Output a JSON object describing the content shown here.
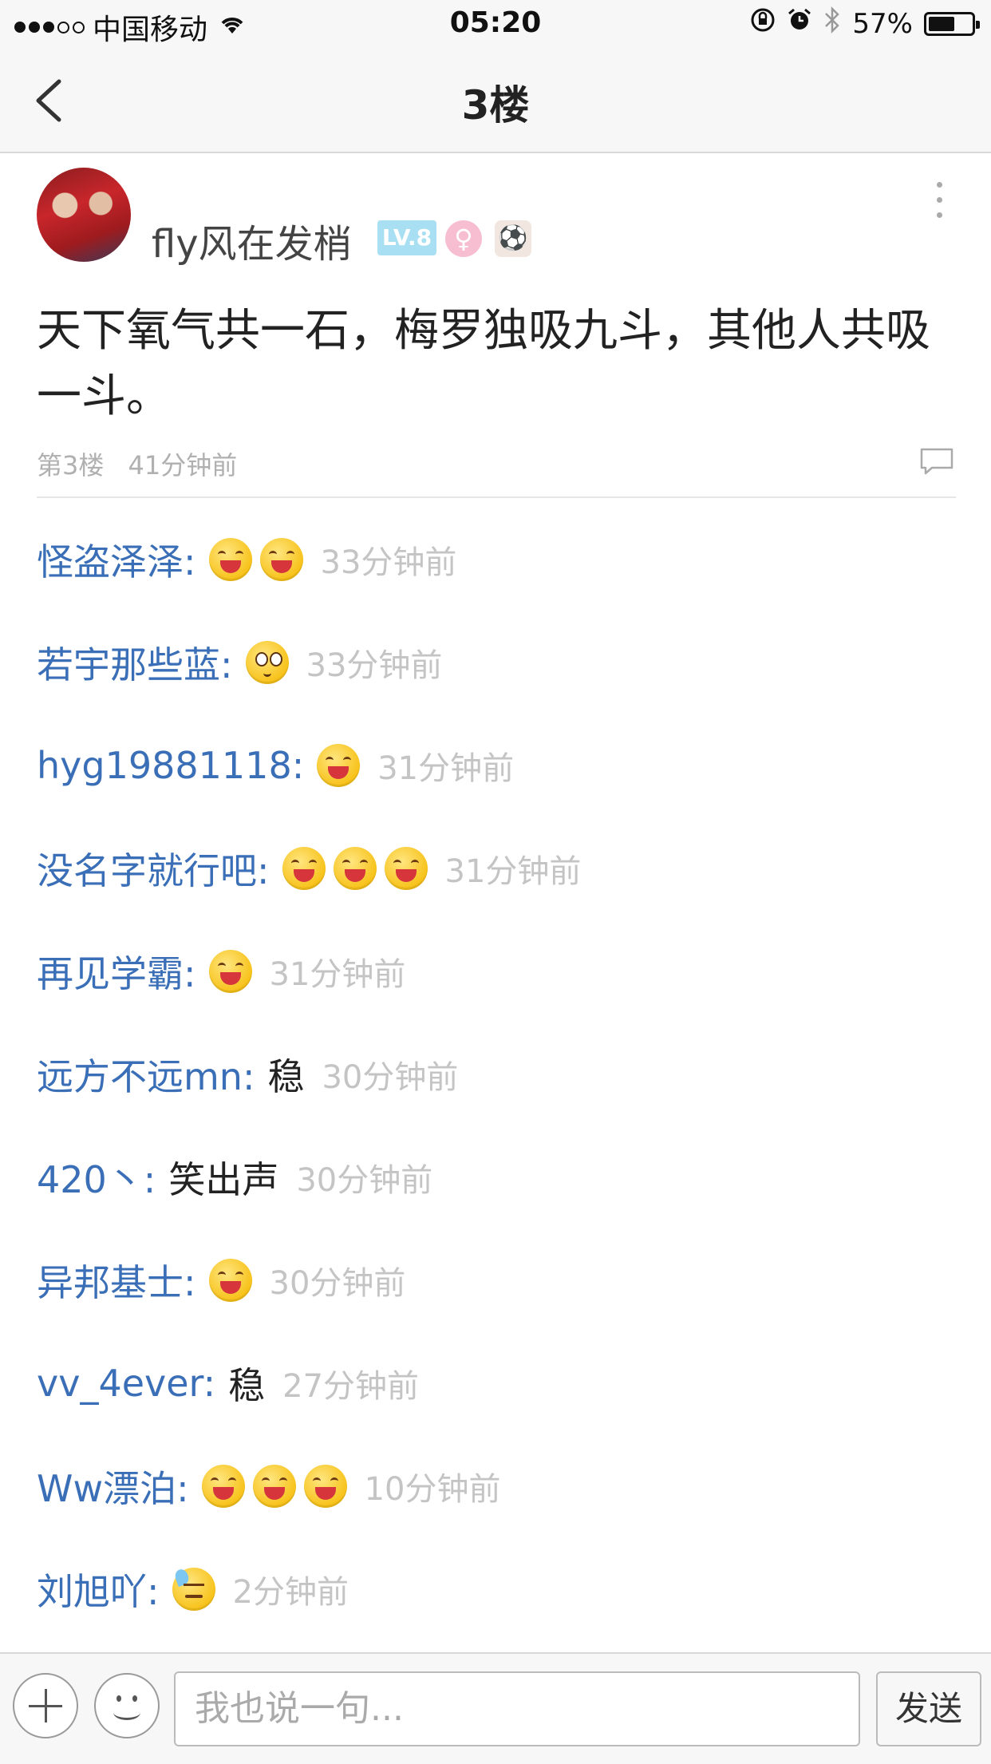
{
  "status_bar": {
    "carrier": "中国移动",
    "time": "05:20",
    "battery": "57%",
    "battery_level": 0.57
  },
  "nav": {
    "title": "3楼"
  },
  "post": {
    "username": "fly风在发梢",
    "level_badge": "LV.8",
    "gender_icon": "female-symbol-icon",
    "content": "天下氧气共一石，梅罗独吸九斗，其他人共吸一斗。",
    "floor": "第3楼",
    "time": "41分钟前"
  },
  "replies": [
    {
      "name": "怪盗泽泽:",
      "text": "",
      "emojis": [
        "laugh",
        "laugh"
      ],
      "time": "33分钟前"
    },
    {
      "name": "若宇那些蓝:",
      "text": "",
      "emojis": [
        "shy"
      ],
      "time": "33分钟前"
    },
    {
      "name": "hyg19881118:",
      "text": "",
      "emojis": [
        "laugh"
      ],
      "time": "31分钟前"
    },
    {
      "name": "没名字就行吧:",
      "text": "",
      "emojis": [
        "laugh",
        "laugh",
        "laugh"
      ],
      "time": "31分钟前"
    },
    {
      "name": "再见学霸:",
      "text": "",
      "emojis": [
        "laugh"
      ],
      "time": "31分钟前"
    },
    {
      "name": "远方不远mn:",
      "text": "稳",
      "emojis": [],
      "time": "30分钟前"
    },
    {
      "name": "420丶:",
      "text": "笑出声",
      "emojis": [],
      "time": "30分钟前"
    },
    {
      "name": "异邦基士:",
      "text": "",
      "emojis": [
        "laugh"
      ],
      "time": "30分钟前"
    },
    {
      "name": "vv_4ever:",
      "text": "稳",
      "emojis": [],
      "time": "27分钟前"
    },
    {
      "name": "Ww漂泊:",
      "text": "",
      "emojis": [
        "laugh",
        "laugh",
        "laugh"
      ],
      "time": "10分钟前"
    },
    {
      "name": "刘旭吖:",
      "text": "",
      "emojis": [
        "sweat"
      ],
      "time": "2分钟前"
    }
  ],
  "bottom_bar": {
    "input_placeholder": "我也说一句...",
    "send_label": "发送"
  }
}
